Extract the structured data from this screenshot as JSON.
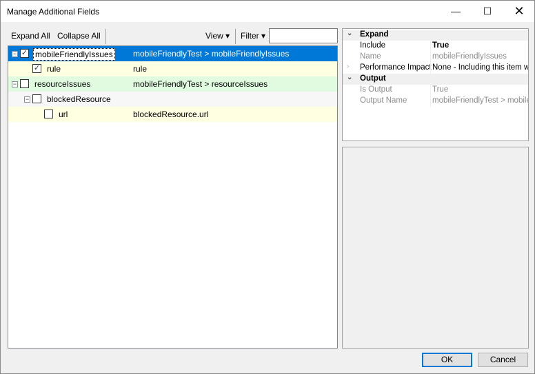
{
  "window": {
    "title": "Manage Additional Fields",
    "minimize_icon": "minimize-icon",
    "maximize_icon": "maximize-icon",
    "close_icon": "close-icon"
  },
  "toolbar": {
    "expand_all": "Expand All",
    "collapse_all": "Collapse All",
    "view": "View ▾",
    "filter": "Filter ▾",
    "filter_value": ""
  },
  "tree": [
    {
      "name": "mobileFriendlyIssues",
      "path": "mobileFriendlyTest > mobileFriendlyIssues",
      "checked": true,
      "selected": true
    },
    {
      "name": "rule",
      "path": "rule",
      "checked": true
    },
    {
      "name": "resourceIssues",
      "path": "mobileFriendlyTest > resourceIssues",
      "checked": false
    },
    {
      "name": "blockedResource",
      "path": "",
      "checked": false
    },
    {
      "name": "url",
      "path": "blockedResource.url",
      "checked": false
    }
  ],
  "properties": {
    "cat_expand": "Expand",
    "include_label": "Include",
    "include_value": "True",
    "name_label": "Name",
    "name_value": "mobileFriendlyIssues",
    "perf_label": "Performance Impact",
    "perf_value": "None - Including this item will",
    "cat_output": "Output",
    "is_output_label": "Is Output",
    "is_output_value": "True",
    "output_name_label": "Output Name",
    "output_name_value": "mobileFriendlyTest > mobileFri"
  },
  "buttons": {
    "ok": "OK",
    "cancel": "Cancel"
  }
}
